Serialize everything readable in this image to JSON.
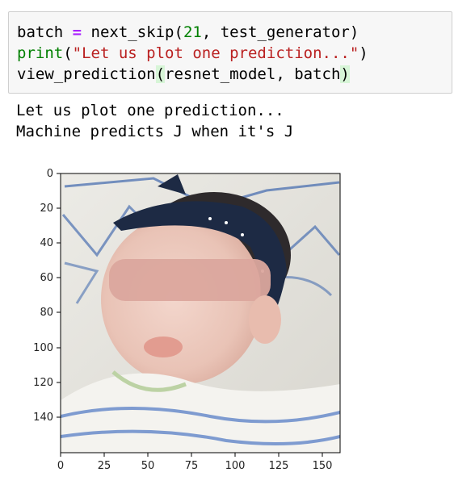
{
  "cell": {
    "code_lines": [
      {
        "tokens": [
          {
            "text": "batch ",
            "type": "plain"
          },
          {
            "text": "=",
            "type": "op"
          },
          {
            "text": " next_skip(",
            "type": "plain"
          },
          {
            "text": "21",
            "type": "num"
          },
          {
            "text": ", test_generator)",
            "type": "plain"
          }
        ]
      },
      {
        "tokens": [
          {
            "text": "print",
            "type": "builtin"
          },
          {
            "text": "(",
            "type": "plain"
          },
          {
            "text": "\"Let us plot one prediction...\"",
            "type": "str"
          },
          {
            "text": ")",
            "type": "plain"
          }
        ]
      },
      {
        "tokens": [
          {
            "text": "view_prediction",
            "type": "plain"
          },
          {
            "text": "(",
            "type": "paren-hl"
          },
          {
            "text": "resnet_model, batch",
            "type": "plain"
          },
          {
            "text": ")",
            "type": "paren-hl"
          }
        ]
      }
    ]
  },
  "output": {
    "lines": [
      "Let us plot one prediction...",
      "Machine predicts J when it's J"
    ]
  },
  "plot": {
    "x_ticks": [
      "0",
      "25",
      "50",
      "75",
      "100",
      "125",
      "150"
    ],
    "y_ticks": [
      "0",
      "20",
      "40",
      "60",
      "80",
      "100",
      "120",
      "140"
    ],
    "x_tick_values": [
      0,
      25,
      50,
      75,
      100,
      125,
      150
    ],
    "y_tick_values": [
      0,
      20,
      40,
      60,
      80,
      100,
      120,
      140
    ],
    "xlim": [
      0,
      160
    ],
    "ylim": [
      160,
      0
    ]
  },
  "colors": {
    "code_bg": "#f7f7f7",
    "code_border": "#cfcfcf",
    "operator": "#aa22ff",
    "number": "#008000",
    "builtin": "#008000",
    "string": "#ba2121",
    "paren_highlight": "#d7f5d7"
  }
}
